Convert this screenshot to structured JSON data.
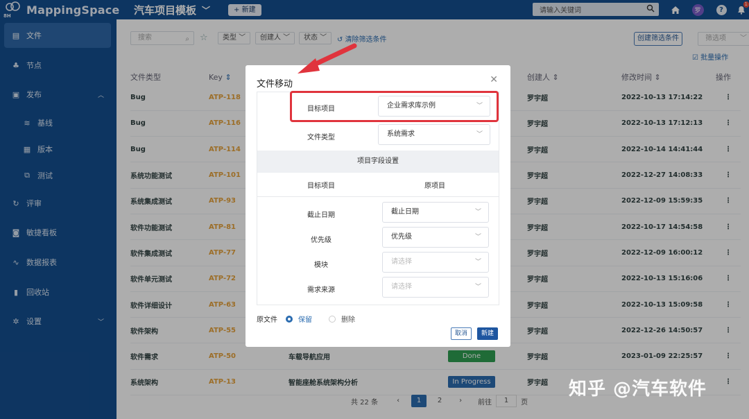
{
  "app": {
    "logo_small": "8H",
    "logo_text": "MappingSpace",
    "project_title": "汽车项目模板",
    "new_label": "+ 新建",
    "search_placeholder": "请输入关键词",
    "user_avatar": "罗",
    "bell_badge": "1"
  },
  "sidebar": {
    "items": [
      {
        "label": "文件",
        "icon": "file-icon"
      },
      {
        "label": "节点",
        "icon": "node-icon"
      },
      {
        "label": "发布",
        "icon": "publish-icon"
      },
      {
        "label": "基线",
        "icon": "baseline-icon"
      },
      {
        "label": "版本",
        "icon": "version-icon"
      },
      {
        "label": "测试",
        "icon": "test-icon"
      },
      {
        "label": "评审",
        "icon": "review-icon"
      },
      {
        "label": "敏捷看板",
        "icon": "kanban-icon"
      },
      {
        "label": "数据报表",
        "icon": "report-icon"
      },
      {
        "label": "回收站",
        "icon": "trash-icon"
      },
      {
        "label": "设置",
        "icon": "settings-icon"
      }
    ]
  },
  "filters": {
    "search_placeholder": "搜索",
    "type": "类型",
    "creator": "创建人",
    "status": "状态",
    "clear": "清除筛选条件",
    "create_filter": "创建筛选条件",
    "choose_filter": "筛选项",
    "batch": "批量操作"
  },
  "table": {
    "headers": {
      "type": "文件类型",
      "key": "Key",
      "creator": "创建人",
      "modified": "修改时间",
      "action": "操作"
    },
    "rows": [
      {
        "type": "Bug",
        "key": "ATP-118",
        "name": "",
        "status": "",
        "creator": "罗宇超",
        "modified": "2022-10-13 17:14:22"
      },
      {
        "type": "Bug",
        "key": "ATP-116",
        "name": "",
        "status": "",
        "creator": "罗宇超",
        "modified": "2022-10-13 17:12:13"
      },
      {
        "type": "Bug",
        "key": "ATP-114",
        "name": "",
        "status": "",
        "creator": "罗宇超",
        "modified": "2022-10-14 14:41:44"
      },
      {
        "type": "系统功能测试",
        "key": "ATP-101",
        "name": "",
        "status": "",
        "creator": "罗宇超",
        "modified": "2022-12-27 14:08:33"
      },
      {
        "type": "系统集成测试",
        "key": "ATP-93",
        "name": "",
        "status": "",
        "creator": "罗宇超",
        "modified": "2022-12-09 15:59:35"
      },
      {
        "type": "软件功能测试",
        "key": "ATP-81",
        "name": "",
        "status": "",
        "creator": "罗宇超",
        "modified": "2022-10-17 14:54:58"
      },
      {
        "type": "软件集成测试",
        "key": "ATP-77",
        "name": "",
        "status": "",
        "creator": "罗宇超",
        "modified": "2022-12-09 16:00:12"
      },
      {
        "type": "软件单元测试",
        "key": "ATP-72",
        "name": "",
        "status": "",
        "creator": "罗宇超",
        "modified": "2022-10-13 15:16:06"
      },
      {
        "type": "软件详细设计",
        "key": "ATP-63",
        "name": "",
        "status": "",
        "creator": "罗宇超",
        "modified": "2022-10-13 15:09:58"
      },
      {
        "type": "软件架构",
        "key": "ATP-55",
        "name": "",
        "status": "",
        "creator": "罗宇超",
        "modified": "2022-12-26 14:50:57"
      },
      {
        "type": "软件需求",
        "key": "ATP-50",
        "name": "车载导航应用",
        "status": "Done",
        "creator": "罗宇超",
        "modified": "2023-01-09 22:25:57"
      },
      {
        "type": "系统架构",
        "key": "ATP-13",
        "name": "智能座舱系统架构分析",
        "status": "In Progress",
        "creator": "罗宇超",
        "modified": ""
      }
    ]
  },
  "pagination": {
    "total": "共 22 条",
    "page1": "1",
    "page2": "2",
    "goto_label": "前往",
    "goto_value": "1",
    "page_suffix": "页"
  },
  "modal": {
    "title": "文件移动",
    "target_project_label": "目标项目",
    "target_project_value": "企业需求库示例",
    "file_type_label": "文件类型",
    "file_type_value": "系统需求",
    "section_title": "项目字段设置",
    "col_target": "目标项目",
    "col_origin": "原项目",
    "fields": [
      {
        "label": "截止日期",
        "value": "截止日期",
        "placeholder": false
      },
      {
        "label": "优先级",
        "value": "优先级",
        "placeholder": false
      },
      {
        "label": "模块",
        "value": "请选择",
        "placeholder": true
      },
      {
        "label": "需求来源",
        "value": "请选择",
        "placeholder": true
      }
    ],
    "origin_label": "原文件",
    "keep_label": "保留",
    "delete_label": "删除",
    "cancel_label": "取消",
    "ok_label": "新建"
  },
  "watermark": "知乎 @汽车软件",
  "colors": {
    "brand": "#144e8f",
    "key": "#e6a23c",
    "done": "#2e9e52",
    "in_progress": "#2b6cb0",
    "highlight": "#e0343d"
  }
}
